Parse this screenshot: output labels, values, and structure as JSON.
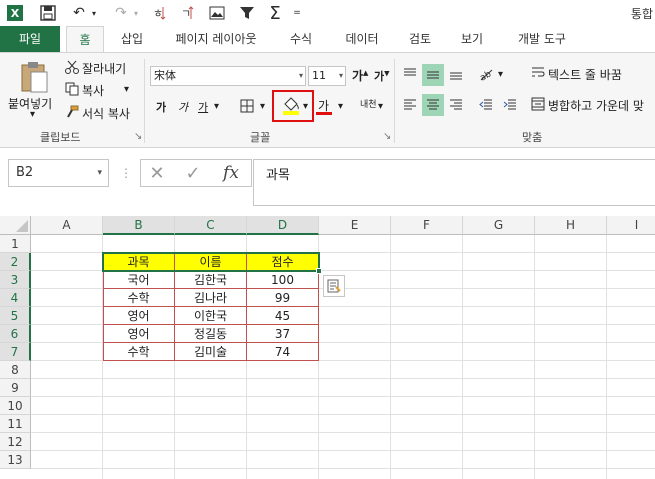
{
  "title_partial": "통합",
  "tabs": [
    "파일",
    "홈",
    "삽입",
    "페이지 레이아웃",
    "수식",
    "데이터",
    "검토",
    "보기",
    "개발 도구"
  ],
  "clipboard": {
    "paste_label": "붙여넣기",
    "cut_label": "잘라내기",
    "copy_label": "복사",
    "format_painter_label": "서식 복사",
    "group_label": "클립보드"
  },
  "font": {
    "font_name": "宋体",
    "font_size": "11",
    "grow_label": "가",
    "shrink_label": "가",
    "bold_label": "가",
    "italic_label": "가",
    "underline_label": "가",
    "font_color_label": "가",
    "phonetic_label": "내천",
    "group_label": "글꼴"
  },
  "alignment": {
    "wrap_text_label": "텍스트 줄 바꿈",
    "merge_center_label": "병합하고 가운데 맞",
    "group_label": "맞춤"
  },
  "formula_bar": {
    "name_box": "B2",
    "formula": "과목"
  },
  "sheet": {
    "columns": [
      "A",
      "B",
      "C",
      "D",
      "E",
      "F",
      "G",
      "H",
      "I"
    ],
    "rows": [
      "1",
      "2",
      "3",
      "4",
      "5",
      "6",
      "7",
      "8",
      "9",
      "10",
      "11",
      "12",
      "13"
    ],
    "table_headers": [
      "과목",
      "이름",
      "점수"
    ],
    "table_rows": [
      [
        "국어",
        "김한국",
        "100"
      ],
      [
        "수학",
        "김나라",
        "99"
      ],
      [
        "영어",
        "이한국",
        "45"
      ],
      [
        "영어",
        "정길동",
        "37"
      ],
      [
        "수학",
        "김미술",
        "74"
      ]
    ]
  },
  "colors": {
    "accent": "#217346",
    "header_fill": "#ffff00",
    "table_border": "#c0504d",
    "highlight": "#e01010"
  }
}
